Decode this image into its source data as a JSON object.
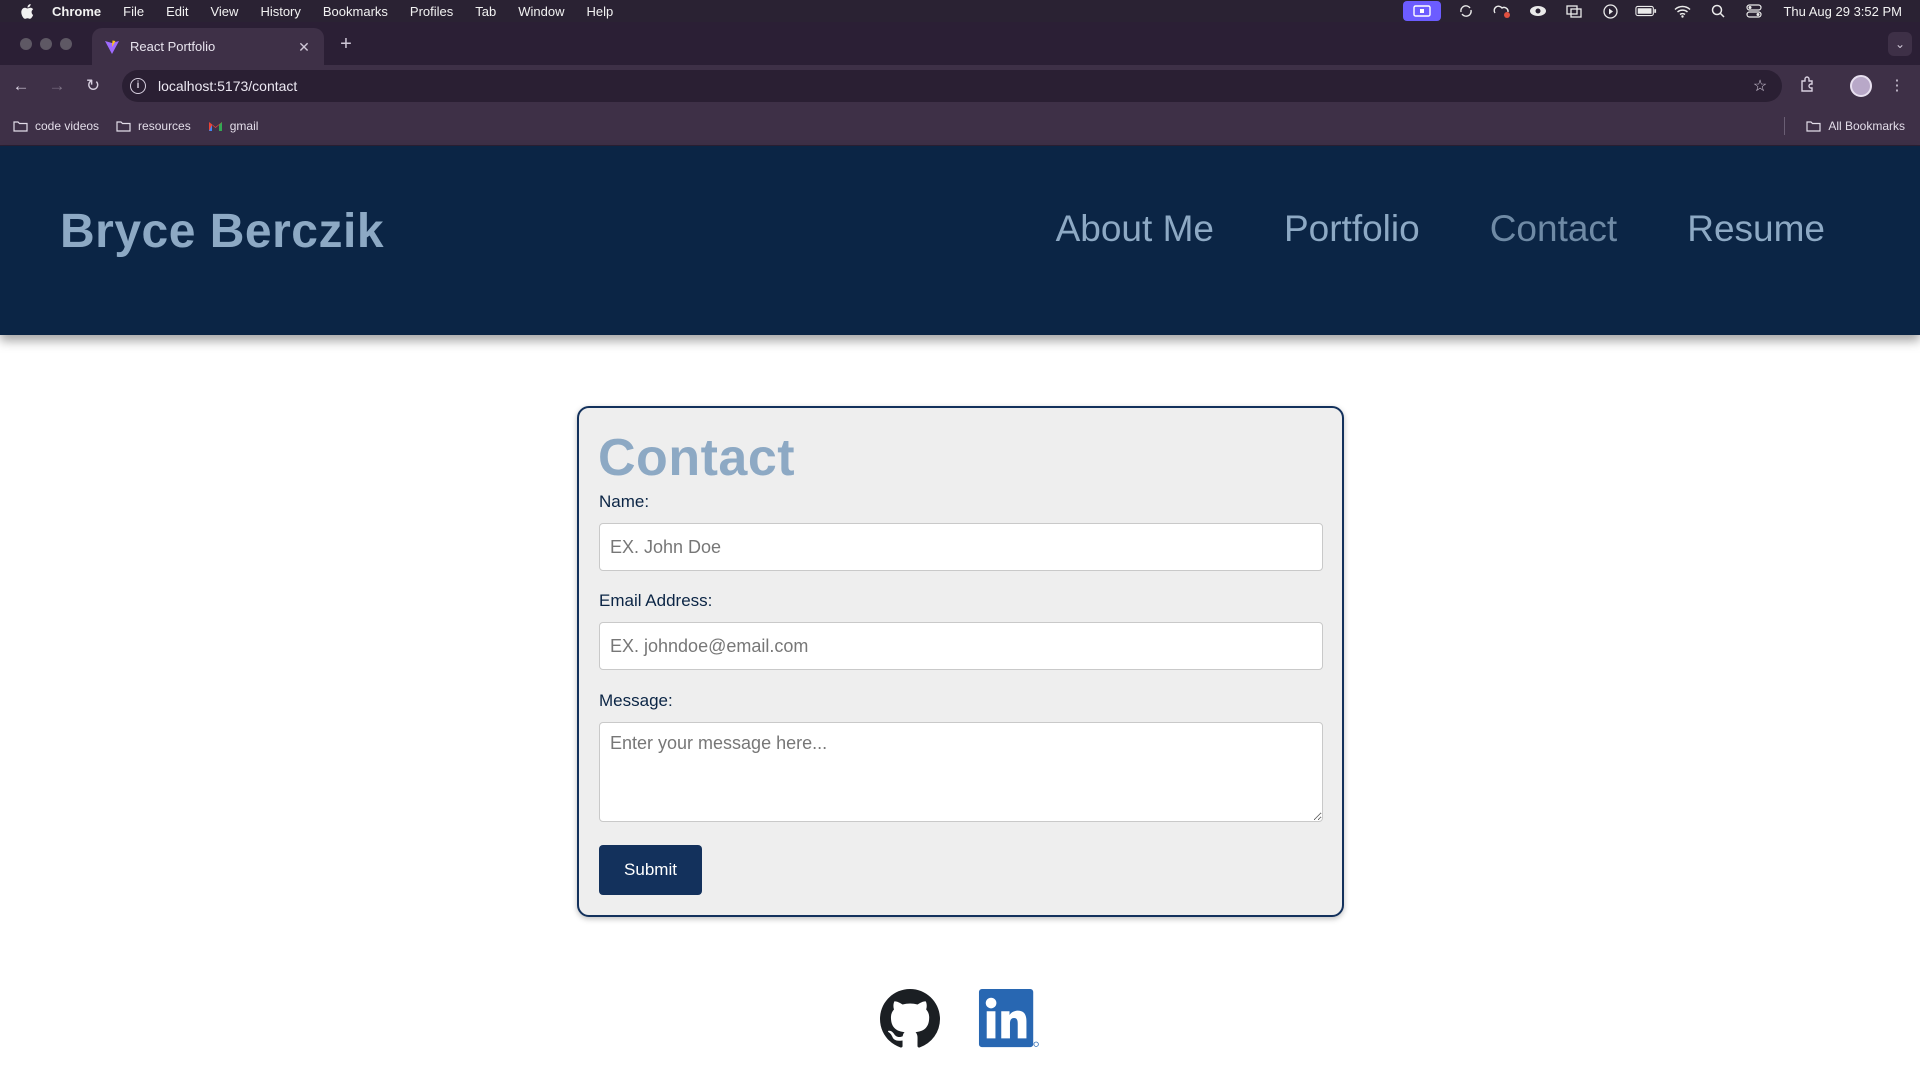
{
  "menubar": {
    "app": "Chrome",
    "items": [
      "File",
      "Edit",
      "View",
      "History",
      "Bookmarks",
      "Profiles",
      "Tab",
      "Window",
      "Help"
    ],
    "clock": "Thu Aug 29  3:52 PM"
  },
  "browser": {
    "tab_title": "React Portfolio",
    "url": "localhost:5173/contact",
    "bookmarks": [
      "code videos",
      "resources",
      "gmail"
    ],
    "all_bookmarks": "All Bookmarks"
  },
  "site": {
    "brand": "Bryce Berczik",
    "nav": [
      "About Me",
      "Portfolio",
      "Contact",
      "Resume"
    ],
    "active_nav": "Contact"
  },
  "contact": {
    "heading": "Contact",
    "name_label": "Name:",
    "name_placeholder": "EX. John Doe",
    "email_label": "Email Address:",
    "email_placeholder": "EX. johndoe@email.com",
    "message_label": "Message:",
    "message_placeholder": "Enter your message here...",
    "submit_label": "Submit"
  },
  "footer": {
    "icons": [
      "github-icon",
      "linkedin-icon"
    ]
  },
  "colors": {
    "header_bg": "#0b2545",
    "brand_text": "#8da9c4",
    "button_bg": "#13315c",
    "card_bg": "#eeeeee"
  }
}
